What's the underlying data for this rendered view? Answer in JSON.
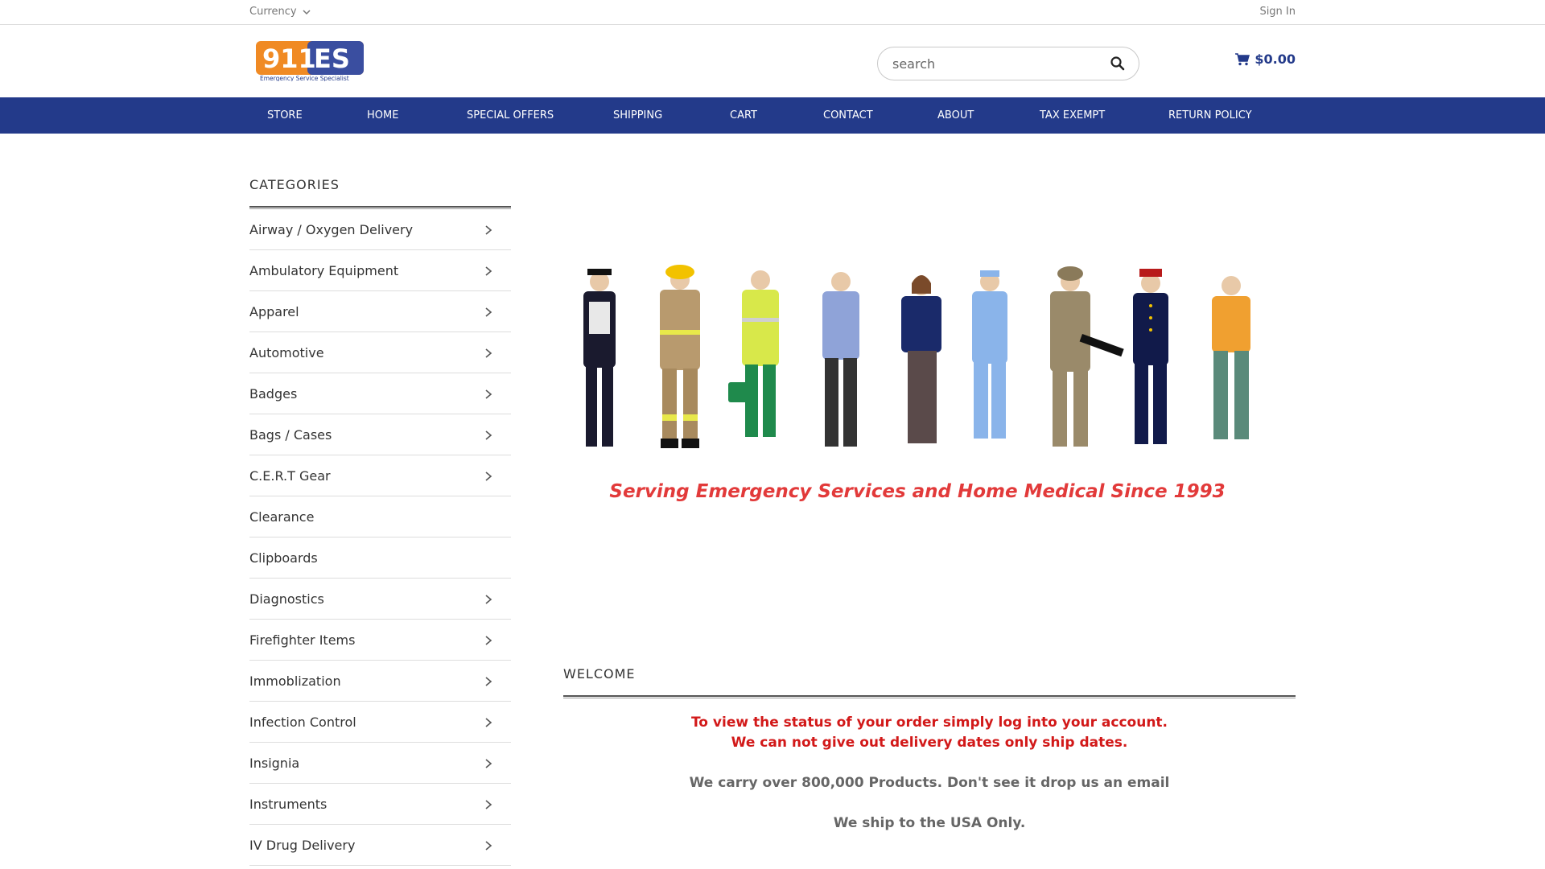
{
  "topbar": {
    "currency_label": "Currency",
    "signin_label": "Sign In"
  },
  "header": {
    "logo_text": "911ES",
    "logo_subtext": "Emergency Service Specialist",
    "search_placeholder": "search",
    "cart_total": "$0.00"
  },
  "nav": {
    "items": [
      "STORE",
      "HOME",
      "SPECIAL OFFERS",
      "SHIPPING",
      "CART",
      "CONTACT",
      "ABOUT",
      "TAX EXEMPT",
      "RETURN POLICY"
    ]
  },
  "sidebar": {
    "title": "CATEGORIES",
    "items": [
      {
        "label": "Airway / Oxygen Delivery",
        "has_sub": true
      },
      {
        "label": "Ambulatory Equipment",
        "has_sub": true
      },
      {
        "label": "Apparel",
        "has_sub": true
      },
      {
        "label": "Automotive",
        "has_sub": true
      },
      {
        "label": "Badges",
        "has_sub": true
      },
      {
        "label": "Bags / Cases",
        "has_sub": true
      },
      {
        "label": "C.E.R.T Gear",
        "has_sub": true
      },
      {
        "label": "Clearance",
        "has_sub": false
      },
      {
        "label": "Clipboards",
        "has_sub": false
      },
      {
        "label": "Diagnostics",
        "has_sub": true
      },
      {
        "label": "Firefighter Items",
        "has_sub": true
      },
      {
        "label": "Immoblization",
        "has_sub": true
      },
      {
        "label": "Infection Control",
        "has_sub": true
      },
      {
        "label": "Insignia",
        "has_sub": true
      },
      {
        "label": "Instruments",
        "has_sub": true
      },
      {
        "label": "IV Drug Delivery",
        "has_sub": true
      }
    ]
  },
  "banner": {
    "caption": "Serving Emergency Services and Home Medical Since 1993"
  },
  "welcome": {
    "title": "WELCOME",
    "notice_line1": "To view the status of your order simply log into your account.",
    "notice_line2": "We can not give out delivery dates only ship dates.",
    "info_line": "We carry over 800,000 Products. Don't see it drop us an email",
    "ship_line": "We ship to the USA Only."
  },
  "colors": {
    "nav_bg": "#233a8a",
    "brand_orange": "#f08a24",
    "notice_red": "#d21919"
  }
}
